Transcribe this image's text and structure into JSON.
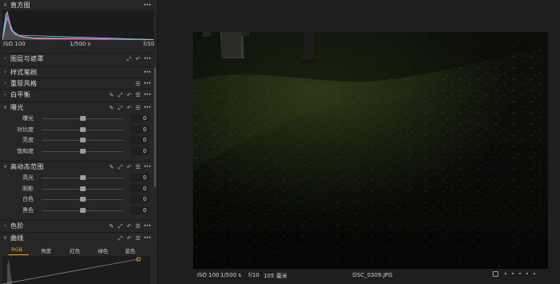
{
  "histogram": {
    "title": "直方图",
    "iso": "ISO 100",
    "shutter": "1/500 s",
    "aperture": "f/10"
  },
  "sections": {
    "layers": "图层与遮罩",
    "styles": "样式笔刷",
    "recolor": "重现风格",
    "white_balance": "白平衡",
    "exposure": "曝光",
    "hdr": "高动态范围",
    "levels": "色阶",
    "curve": "曲线"
  },
  "exposure_sliders": [
    {
      "label": "曝光",
      "value": "0",
      "position": 0.5
    },
    {
      "label": "对比度",
      "value": "0",
      "position": 0.5
    },
    {
      "label": "亮度",
      "value": "0",
      "position": 0.5
    },
    {
      "label": "饱和度",
      "value": "0",
      "position": 0.5
    }
  ],
  "hdr_sliders": [
    {
      "label": "高光",
      "value": "0",
      "position": 0.5
    },
    {
      "label": "阴影",
      "value": "0",
      "position": 0.5
    },
    {
      "label": "白色",
      "value": "0",
      "position": 0.5
    },
    {
      "label": "黑色",
      "value": "0",
      "position": 0.5
    }
  ],
  "curve_tabs": [
    "RGB",
    "亮度",
    "红色",
    "绿色",
    "蓝色"
  ],
  "curve_active_tab": "RGB",
  "viewer": {
    "iso": "ISO 100",
    "shutter": "1/500 s",
    "aperture": "f/10",
    "focal": "105 毫米",
    "filename": "DSC_0309.JPG"
  },
  "colors": {
    "accent": "#e6a23c",
    "panel_bg": "#262626",
    "viewer_bg": "#1e1e1e"
  }
}
